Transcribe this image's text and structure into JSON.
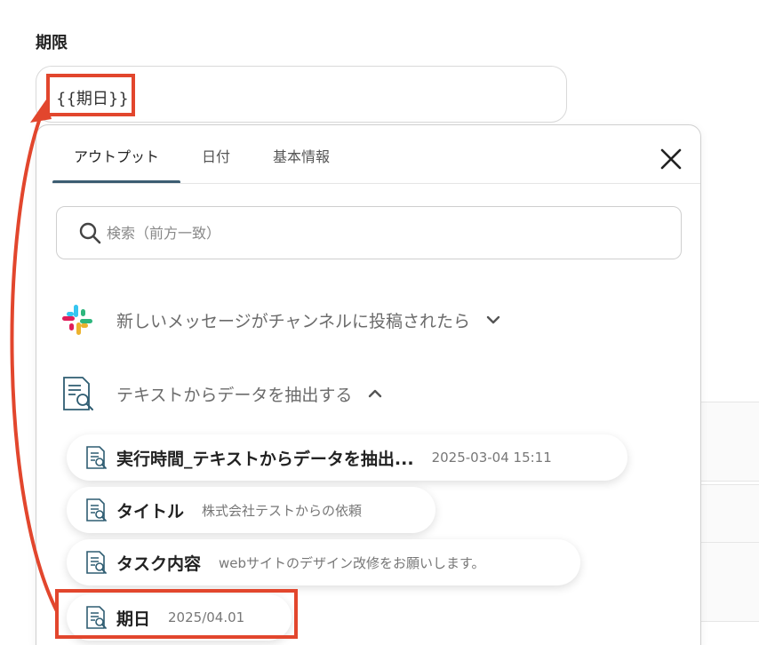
{
  "field": {
    "label": "期限",
    "value": "{{期日}}"
  },
  "tabs": [
    {
      "label": "アウトプット",
      "active": true
    },
    {
      "label": "日付",
      "active": false
    },
    {
      "label": "基本情報",
      "active": false
    }
  ],
  "close_icon": "close-icon",
  "search": {
    "placeholder": "検索（前方一致）",
    "value": "",
    "icon": "search-icon"
  },
  "sections": [
    {
      "title": "新しいメッセージがチャンネルに投稿されたら",
      "icon": "slack-icon",
      "expanded": false
    },
    {
      "title": "テキストからデータを抽出する",
      "icon": "document-search-icon",
      "expanded": true
    }
  ],
  "items": [
    {
      "label": "実行時間_テキストからデータを抽出...",
      "value": "2025-03-04 15:11",
      "icon": "document-search-icon"
    },
    {
      "label": "タイトル",
      "value": "株式会社テストからの依頼",
      "icon": "document-search-icon"
    },
    {
      "label": "タスク内容",
      "value": "webサイトのデザイン改修をお願いします。",
      "icon": "document-search-icon"
    },
    {
      "label": "期日",
      "value": "2025/04.01",
      "icon": "document-search-icon"
    }
  ],
  "colors": {
    "highlight": "#e2462d",
    "tab_indicator": "#3c5d72",
    "icon_teal": "#2f5d72",
    "slack_blue": "#36c5f0",
    "slack_green": "#2eb67d",
    "slack_yellow": "#ecb22e",
    "slack_red": "#e01e5a"
  }
}
